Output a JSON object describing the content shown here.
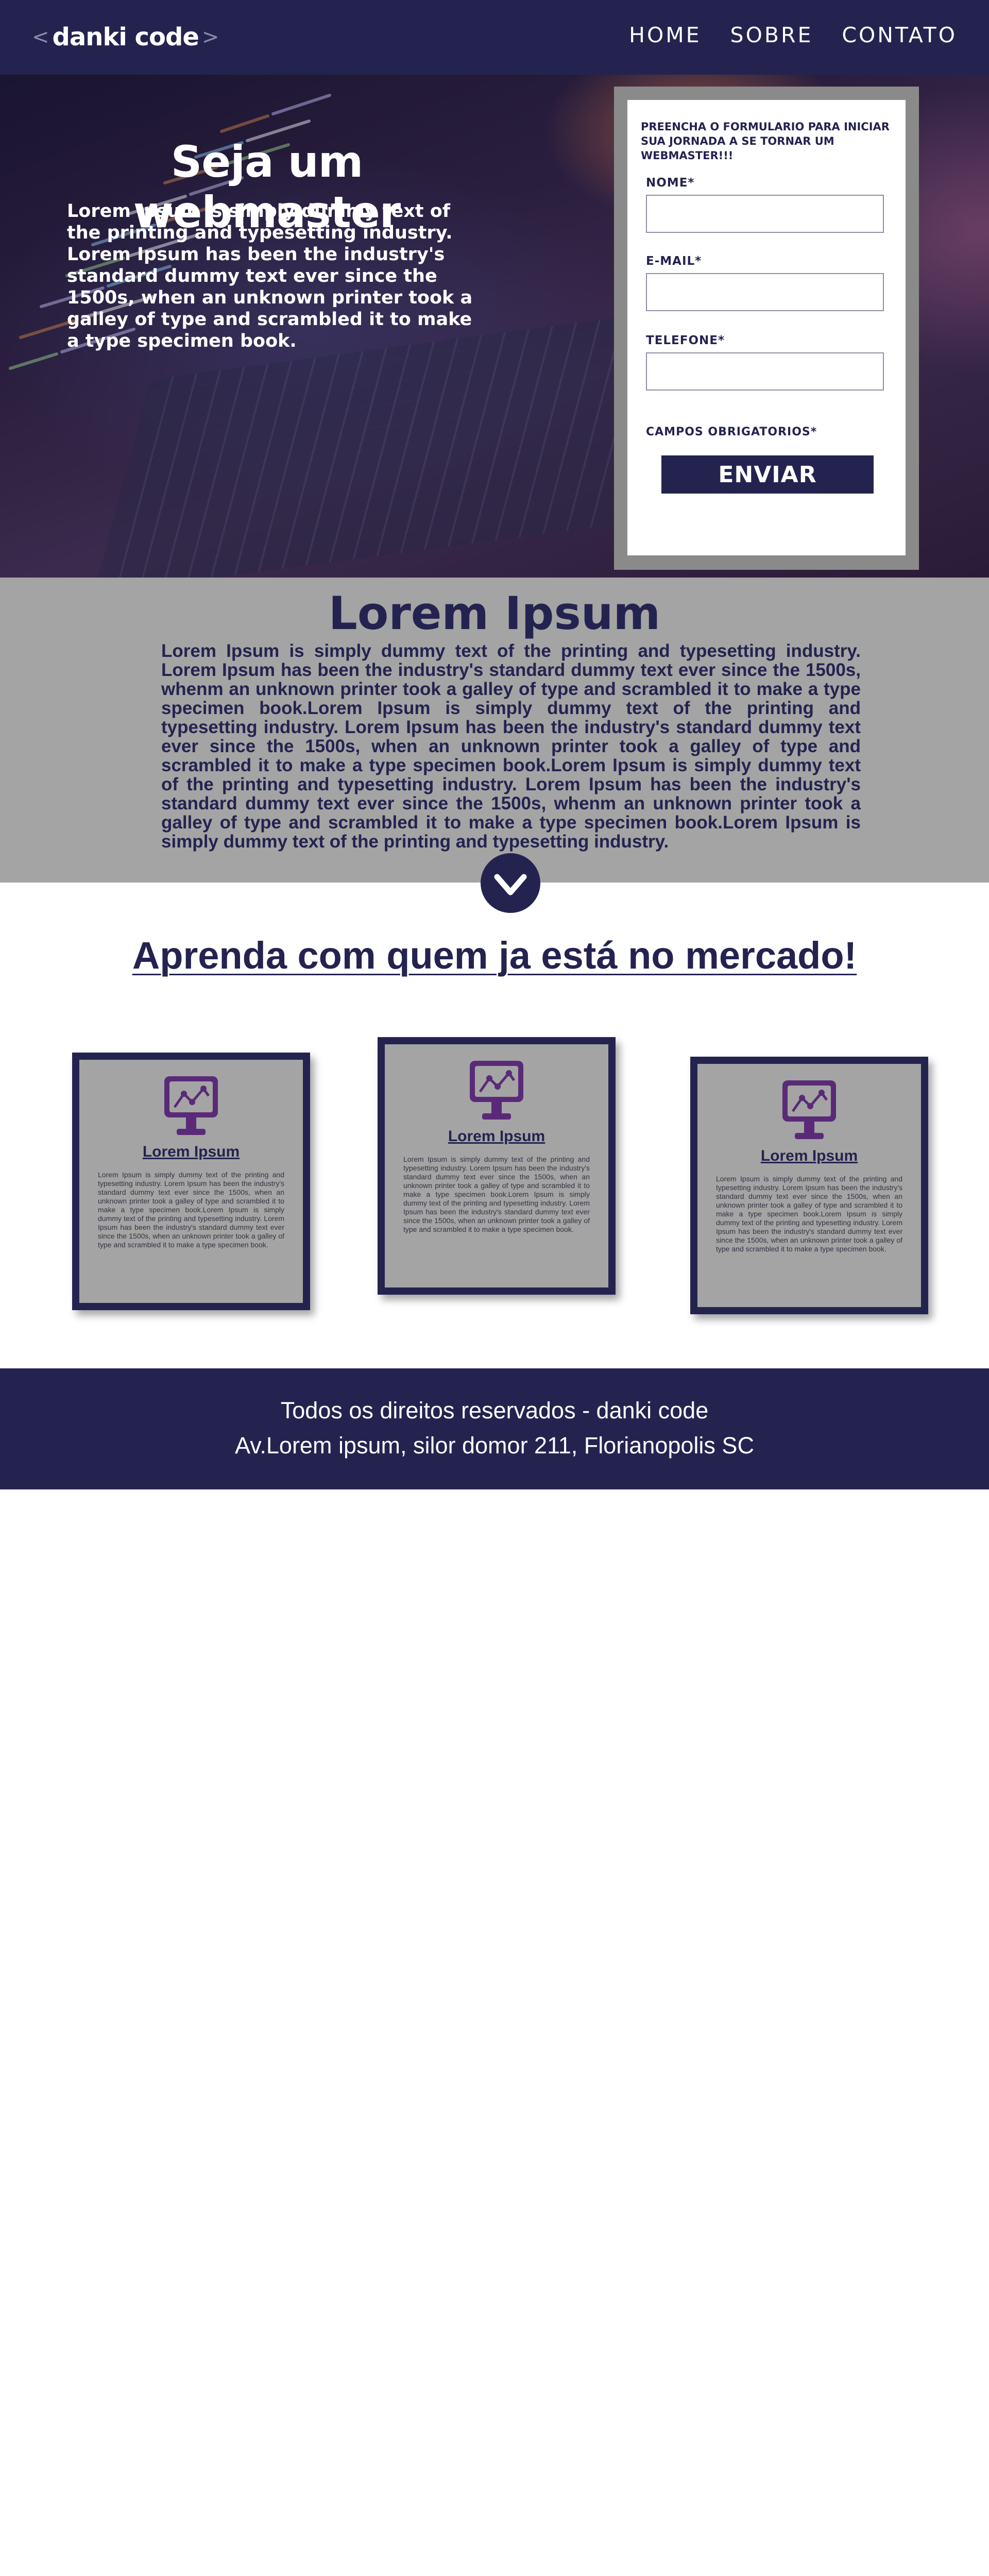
{
  "header": {
    "logo": {
      "bracket_left": "<",
      "text": "danki code",
      "bracket_right": ">"
    },
    "nav": [
      {
        "label": "HOME"
      },
      {
        "label": "SOBRE"
      },
      {
        "label": "CONTATO"
      }
    ]
  },
  "hero": {
    "title": "Seja um webmaster",
    "text": "Lorem Ipsum is simply dummy text of the printing and typesetting industry. Lorem Ipsum has been the industry's standard dummy text ever since the 1500s, when an unknown printer took a galley of type and scrambled it to make a type specimen book."
  },
  "form": {
    "intro": "PREENCHA O FORMULARIO PARA INICIAR SUA JORNADA A SE TORNAR UM WEBMASTER!!!",
    "fields": [
      {
        "label": "NOME*",
        "value": ""
      },
      {
        "label": "E-MAIL*",
        "value": ""
      },
      {
        "label": "TELEFONE*",
        "value": ""
      }
    ],
    "required_note": "CAMPOS OBRIGATORIOS*",
    "submit_label": "ENVIAR"
  },
  "about": {
    "title": "Lorem Ipsum",
    "text": "Lorem Ipsum is simply dummy text of the printing and typesetting industry. Lorem Ipsum has been the industry's standard dummy text ever since the 1500s, whenm an unknown printer took a galley of type and scrambled it to make a type specimen book.Lorem Ipsum is simply dummy text of the printing and typesetting industry. Lorem Ipsum has been the industry's standard dummy text ever since the 1500s, when an unknown printer took a galley of type and scrambled it to make a type specimen book.Lorem Ipsum is simply dummy text of the printing and typesetting industry. Lorem Ipsum has been the industry's standard dummy text ever since the 1500s, whenm an unknown printer took a galley of type and scrambled it to make a type specimen book.Lorem Ipsum is simply dummy text of the printing and typesetting industry."
  },
  "scroll_button": {
    "icon": "chevron-down-icon"
  },
  "learn": {
    "title": "Aprenda com quem ja está no mercado!",
    "cards": [
      {
        "icon": "monitor-chart-icon",
        "title": "Lorem Ipsum",
        "text": "Lorem Ipsum is simply dummy text of the printing and typesetting industry. Lorem Ipsum has been the industry's standard dummy text ever since the 1500s, when an unknown printer took a galley of type and scrambled it to make a type specimen book.Lorem Ipsum is simply dummy text of the printing and typesetting industry. Lorem Ipsum has been the industry's standard dummy text ever since the 1500s, when an unknown printer took a galley of type and scrambled it to make a type specimen book."
      },
      {
        "icon": "monitor-chart-icon",
        "title": "Lorem Ipsum",
        "text": "Lorem Ipsum is simply dummy text of the printing and typesetting industry. Lorem Ipsum has been the industry's standard dummy text ever since the 1500s, when an unknown printer took a galley of type and scrambled it to make a type specimen book.Lorem Ipsum is simply dummy text of the printing and typesetting industry. Lorem Ipsum has been the industry's standard dummy text ever since the 1500s, when an unknown printer took a galley of type and scrambled it to make a type specimen book."
      },
      {
        "icon": "monitor-chart-icon",
        "title": "Lorem Ipsum",
        "text": "Lorem Ipsum is simply dummy text of the printing and typesetting industry. Lorem Ipsum has been the industry's standard dummy text ever since the 1500s, when an unknown printer took a galley of type and scrambled it to make a type specimen book.Lorem Ipsum is simply dummy text of the printing and typesetting industry. Lorem Ipsum has been the industry's standard dummy text ever since the 1500s, when an unknown printer took a galley of type and scrambled it to make a type specimen book."
      }
    ]
  },
  "footer": {
    "line1": "Todos os direitos reservados - danki code",
    "line2": "Av.Lorem ipsum, silor domor 211, Florianopolis SC"
  },
  "colors": {
    "primary": "#242350",
    "grey_section": "#a4a4a4",
    "form_frame": "#8a8a8a",
    "icon_purple": "#5a2a78",
    "white": "#ffffff"
  }
}
